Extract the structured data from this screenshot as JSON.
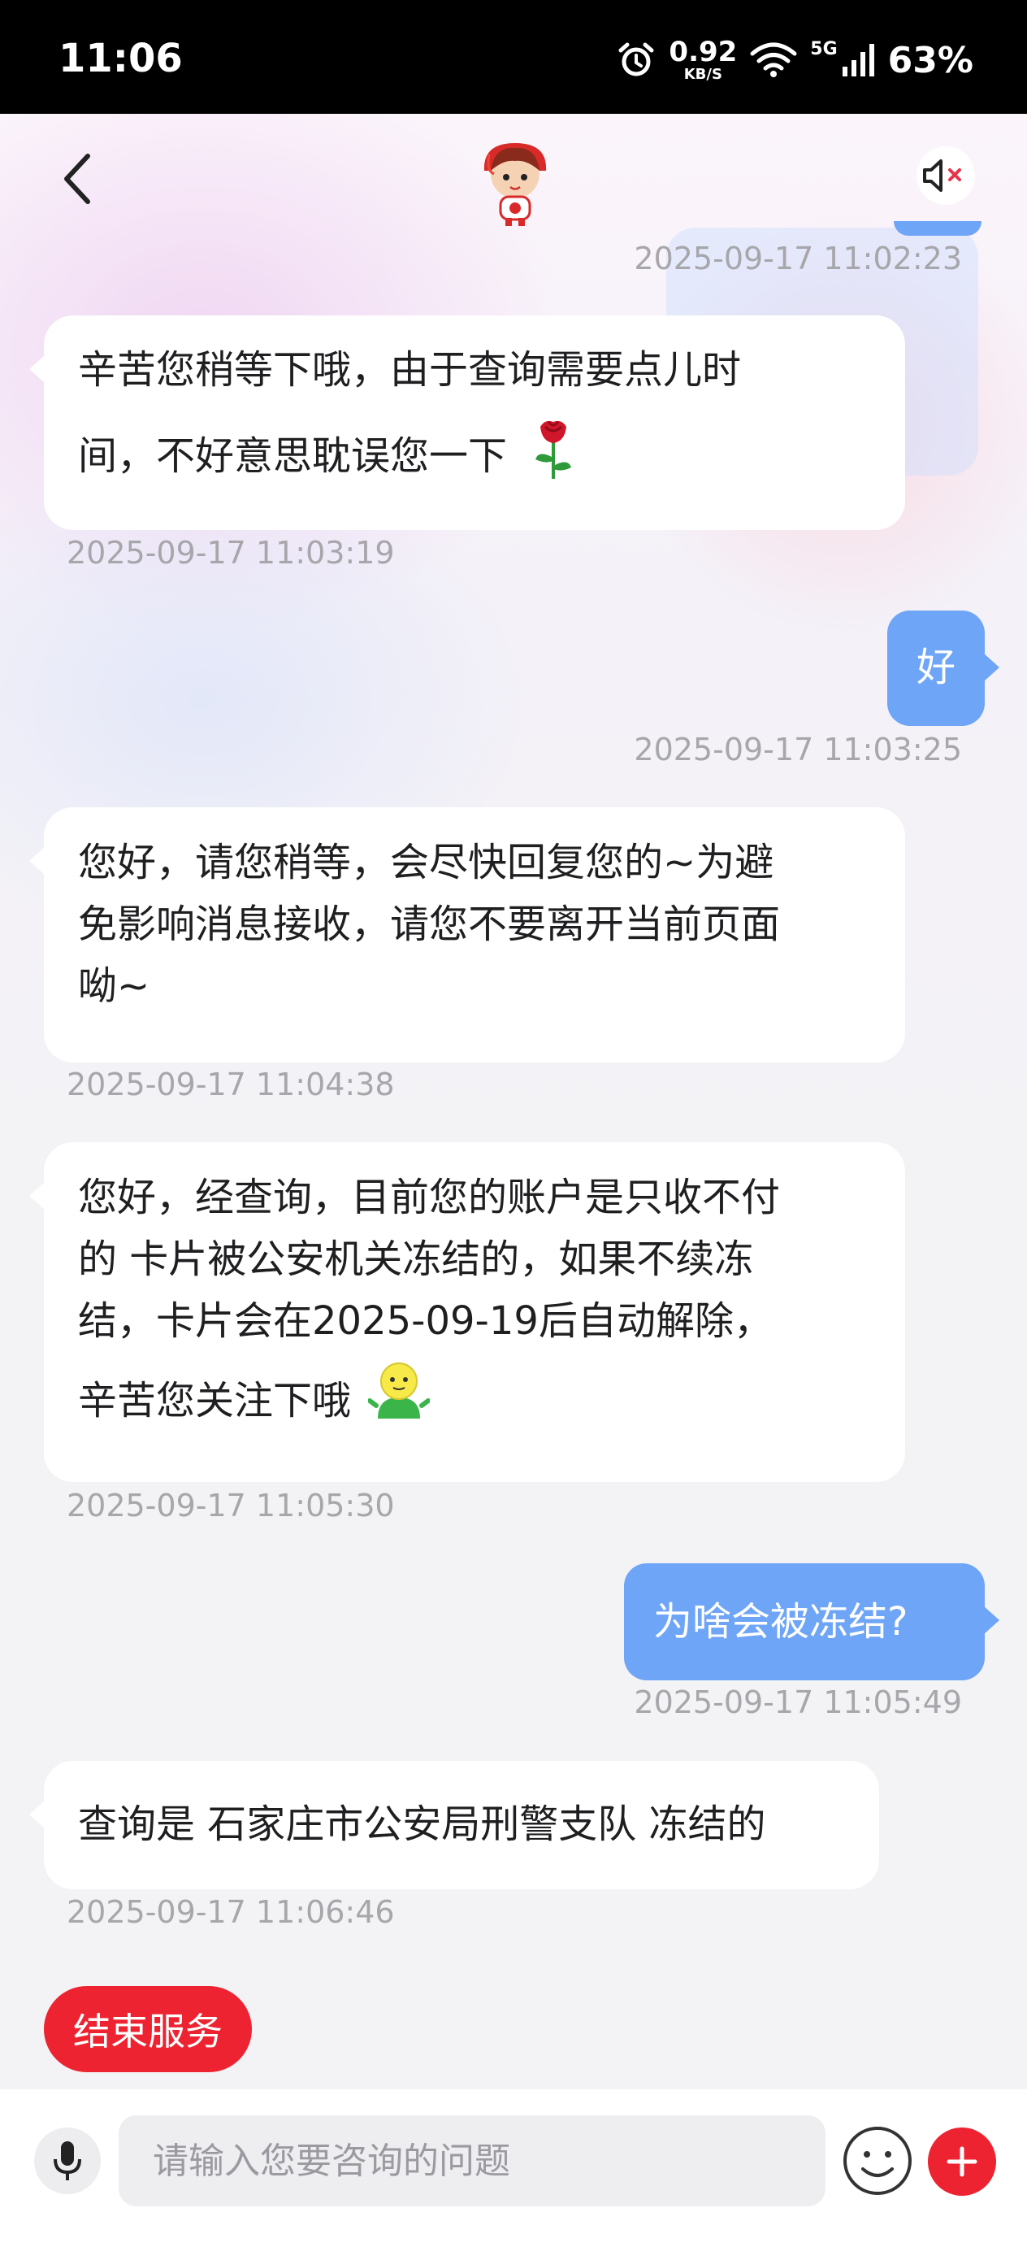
{
  "status_bar": {
    "time": "11:06",
    "net_speed_value": "0.92",
    "net_speed_unit": "KB/S",
    "network_type": "5G",
    "battery": "63%"
  },
  "header": {
    "back_icon": "chevron-left-icon",
    "avatar_icon": "mascot-avatar-icon",
    "mute_icon": "speaker-muted-icon"
  },
  "messages": [
    {
      "side": "out",
      "time": "2025-09-17 11:02:23"
    },
    {
      "side": "in",
      "lines": [
        "辛苦您稍等下哦，由于查询需要点儿时",
        "间，不好意思耽误您一下"
      ],
      "emoji": "rose-icon",
      "time": "2025-09-17 11:03:19"
    },
    {
      "side": "out",
      "text": "好",
      "time": "2025-09-17 11:03:25"
    },
    {
      "side": "in",
      "text": "您好，请您稍等，会尽快回复您的~为避\n免影响消息接收，请您不要离开当前页面\n呦~",
      "time": "2025-09-17 11:04:38"
    },
    {
      "side": "in",
      "text": "您好，经查询，目前您的账户是只收不付\n的 卡片被公安机关冻结的，如果不续冻\n结，卡片会在2025-09-19后自动解除，",
      "last_line": "辛苦您关注下哦",
      "emoji": "smiley-figure-icon",
      "time": "2025-09-17 11:05:30"
    },
    {
      "side": "out",
      "text": "为啥会被冻结?",
      "time": "2025-09-17 11:05:49"
    },
    {
      "side": "in",
      "text": "查询是 石家庄市公安局刑警支队 冻结的",
      "time": "2025-09-17 11:06:46"
    }
  ],
  "end_service_label": "结束服务",
  "input": {
    "placeholder": "请输入您要咨询的问题"
  },
  "colors": {
    "accent_red": "#ee2331",
    "user_bubble": "#6ea5f6",
    "agent_bubble": "#ffffff",
    "timestamp": "#a6a6ab"
  }
}
